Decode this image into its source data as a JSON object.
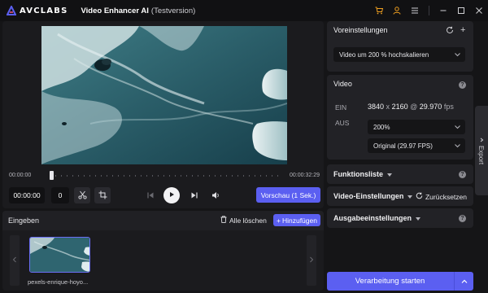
{
  "app": {
    "brand": "AVCLABS",
    "title": "Video Enhancer AI",
    "subtitle": "(Testversion)",
    "accent": "#5b5ff1",
    "icon_accent": "#f0a020"
  },
  "titlebar_icons": [
    "cart-icon",
    "user-icon",
    "menu-icon",
    "minimize-icon",
    "maximize-icon",
    "close-icon"
  ],
  "player": {
    "time_start": "00:00:00",
    "time_end": "00:00:32:29",
    "current_time": "00:00:00",
    "frame": "0",
    "preview_label": "Vorschau (1 Sek.)",
    "position_fraction": 0
  },
  "input": {
    "title": "Eingeben",
    "clear_all": "Alle löschen",
    "add": "Hinzufügen",
    "clip_name": "pexels-enrique-hoyo..."
  },
  "presets": {
    "title": "Voreinstellungen",
    "selected": "Video um 200 % hochskalieren"
  },
  "video": {
    "title": "Video",
    "in_label": "EIN",
    "out_label": "AUS",
    "resolution_w": "3840",
    "resolution_x": "x",
    "resolution_h": "2160",
    "at": "@",
    "fps": "29.970",
    "fps_unit": "fps",
    "scale_selected": "200%",
    "framerate_selected": "Original (29.97 FPS)"
  },
  "sections": {
    "functions": "Funktionsliste",
    "video_settings": "Video-Einstellungen",
    "reset": "Zurücksetzen",
    "output_settings": "Ausgabeeinstellungen"
  },
  "export_tab": "Export",
  "start_label": "Verarbeitung starten"
}
